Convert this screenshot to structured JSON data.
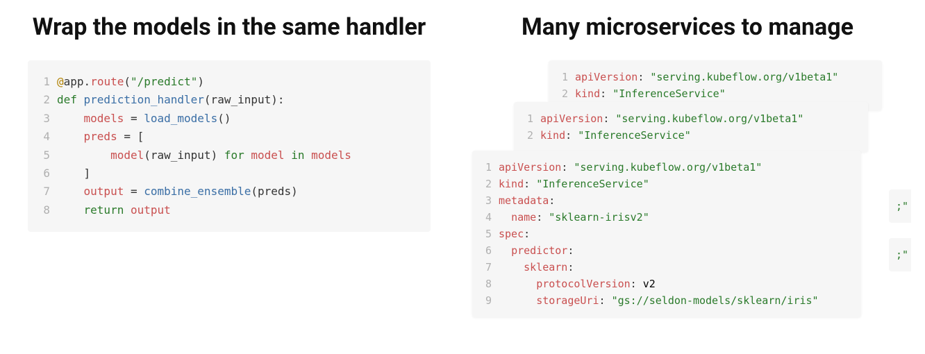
{
  "left": {
    "heading": "Wrap the models in the same handler",
    "code": {
      "tokens": [
        [
          {
            "t": "@",
            "c": "deco"
          },
          {
            "t": "app",
            "c": ""
          },
          {
            "t": ".",
            "c": "punc"
          },
          {
            "t": "route",
            "c": "name"
          },
          {
            "t": "(",
            "c": "punc"
          },
          {
            "t": "\"/predict\"",
            "c": "str"
          },
          {
            "t": ")",
            "c": "punc"
          }
        ],
        [
          {
            "t": "def ",
            "c": "kw"
          },
          {
            "t": "prediction_handler",
            "c": "fn"
          },
          {
            "t": "(raw_input):",
            "c": "punc"
          }
        ],
        [
          {
            "t": "    ",
            "c": ""
          },
          {
            "t": "models",
            "c": "name"
          },
          {
            "t": " = ",
            "c": "punc"
          },
          {
            "t": "load_models",
            "c": "fn"
          },
          {
            "t": "()",
            "c": "punc"
          }
        ],
        [
          {
            "t": "    ",
            "c": ""
          },
          {
            "t": "preds",
            "c": "name"
          },
          {
            "t": " = [",
            "c": "punc"
          }
        ],
        [
          {
            "t": "        ",
            "c": ""
          },
          {
            "t": "model",
            "c": "name"
          },
          {
            "t": "(raw_input) ",
            "c": "punc"
          },
          {
            "t": "for",
            "c": "kw"
          },
          {
            "t": " ",
            "c": ""
          },
          {
            "t": "model",
            "c": "name"
          },
          {
            "t": " ",
            "c": ""
          },
          {
            "t": "in",
            "c": "kw"
          },
          {
            "t": " ",
            "c": ""
          },
          {
            "t": "models",
            "c": "name"
          }
        ],
        [
          {
            "t": "    ]",
            "c": "punc"
          }
        ],
        [
          {
            "t": "    ",
            "c": ""
          },
          {
            "t": "output",
            "c": "name"
          },
          {
            "t": " = ",
            "c": "punc"
          },
          {
            "t": "combine_ensemble",
            "c": "fn"
          },
          {
            "t": "(preds)",
            "c": "punc"
          }
        ],
        [
          {
            "t": "    ",
            "c": ""
          },
          {
            "t": "return",
            "c": "kw"
          },
          {
            "t": " ",
            "c": ""
          },
          {
            "t": "output",
            "c": "name"
          }
        ]
      ]
    }
  },
  "right": {
    "heading": "Many microservices to manage",
    "yaml_boxes": [
      {
        "tokens": [
          [
            {
              "t": "apiVersion",
              "c": "name"
            },
            {
              "t": ": ",
              "c": "punc"
            },
            {
              "t": "\"serving.kubeflow.org/v1beta1\"",
              "c": "str"
            }
          ],
          [
            {
              "t": "kind",
              "c": "name"
            },
            {
              "t": ": ",
              "c": "punc"
            },
            {
              "t": "\"InferenceService\"",
              "c": "str"
            }
          ]
        ]
      },
      {
        "tokens": [
          [
            {
              "t": "apiVersion",
              "c": "name"
            },
            {
              "t": ": ",
              "c": "punc"
            },
            {
              "t": "\"serving.kubeflow.org/v1beta1\"",
              "c": "str"
            }
          ],
          [
            {
              "t": "kind",
              "c": "name"
            },
            {
              "t": ": ",
              "c": "punc"
            },
            {
              "t": "\"InferenceService\"",
              "c": "str"
            }
          ]
        ]
      },
      {
        "tokens": [
          [
            {
              "t": "apiVersion",
              "c": "name"
            },
            {
              "t": ": ",
              "c": "punc"
            },
            {
              "t": "\"serving.kubeflow.org/v1beta1\"",
              "c": "str"
            }
          ],
          [
            {
              "t": "kind",
              "c": "name"
            },
            {
              "t": ": ",
              "c": "punc"
            },
            {
              "t": "\"InferenceService\"",
              "c": "str"
            }
          ],
          [
            {
              "t": "metadata",
              "c": "name"
            },
            {
              "t": ":",
              "c": "punc"
            }
          ],
          [
            {
              "t": "  ",
              "c": ""
            },
            {
              "t": "name",
              "c": "name"
            },
            {
              "t": ": ",
              "c": "punc"
            },
            {
              "t": "\"sklearn-irisv2\"",
              "c": "str"
            }
          ],
          [
            {
              "t": "spec",
              "c": "name"
            },
            {
              "t": ":",
              "c": "punc"
            }
          ],
          [
            {
              "t": "  ",
              "c": ""
            },
            {
              "t": "predictor",
              "c": "name"
            },
            {
              "t": ":",
              "c": "punc"
            }
          ],
          [
            {
              "t": "    ",
              "c": ""
            },
            {
              "t": "sklearn",
              "c": "name"
            },
            {
              "t": ":",
              "c": "punc"
            }
          ],
          [
            {
              "t": "      ",
              "c": ""
            },
            {
              "t": "protocolVersion",
              "c": "name"
            },
            {
              "t": ": ",
              "c": "punc"
            },
            {
              "t": "v2",
              "c": ""
            }
          ],
          [
            {
              "t": "      ",
              "c": ""
            },
            {
              "t": "storageUri",
              "c": "name"
            },
            {
              "t": ": ",
              "c": "punc"
            },
            {
              "t": "\"gs://seldon-models/sklearn/iris\"",
              "c": "str"
            }
          ]
        ]
      }
    ],
    "peek1": ";\"",
    "peek2": ";\""
  }
}
